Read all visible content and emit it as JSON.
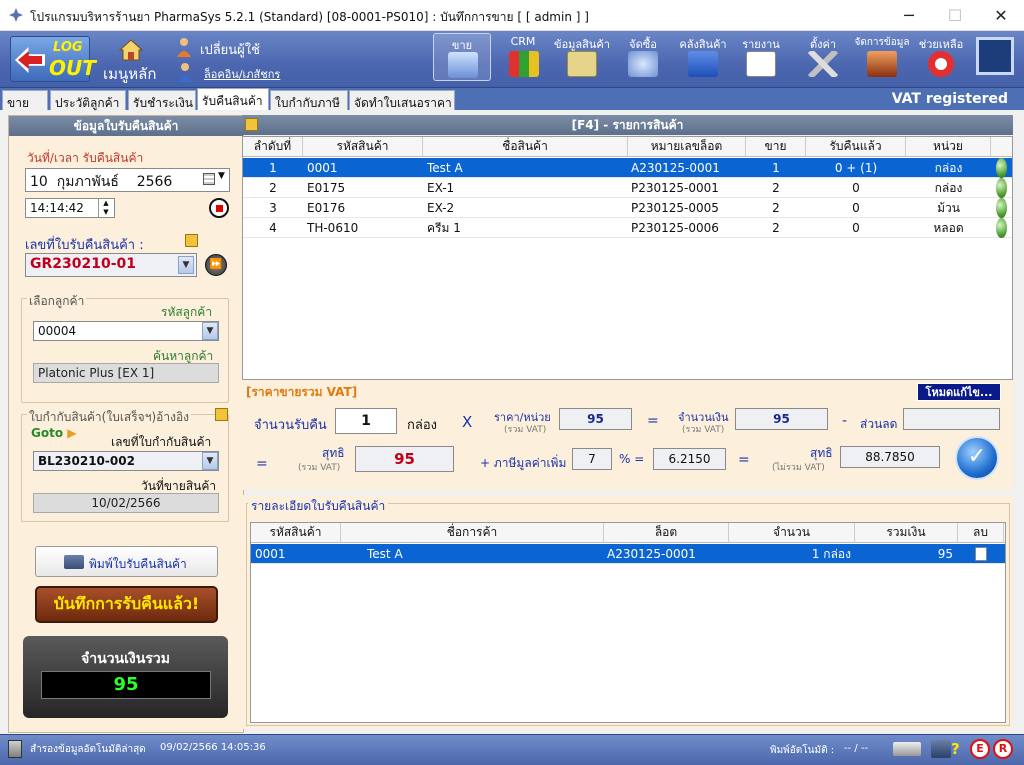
{
  "window": {
    "title": "โปรแกรมบริหารร้านยา PharmaSys 5.2.1 (Standard) [08-0001-PS010] : บันทึกการขาย  [ [ admin ] ]",
    "minimize": "─",
    "maximize": "☐",
    "close": "✕"
  },
  "toolbar": {
    "logout_top": "LOG",
    "logout_bottom": "OUT",
    "home": "เมนูหลัก",
    "change_user": "เปลี่ยนผู้ใช้",
    "login_link": "ล็อคอิน/เภสัชกร",
    "items": [
      {
        "label": "ขาย",
        "icon": "pos-icon"
      },
      {
        "label": "CRM",
        "icon": "crm-icon"
      },
      {
        "label": "ข้อมูลสินค้า",
        "icon": "product-icon"
      },
      {
        "label": "จัดซื้อ",
        "icon": "purchase-icon"
      },
      {
        "label": "คลังสินค้า",
        "icon": "warehouse-icon"
      },
      {
        "label": "รายงาน",
        "icon": "report-icon"
      },
      {
        "label": "ตั้งค่า",
        "icon": "settings-icon"
      },
      {
        "label": "จัดการข้อมูล",
        "icon": "data-icon"
      },
      {
        "label": "ช่วยเหลือ",
        "icon": "help-icon"
      }
    ]
  },
  "tabs": [
    "ขาย",
    "ประวัติลูกค้า",
    "รับชำระเงิน",
    "รับคืนสินค้า",
    "ใบกำกับภาษี",
    "จัดทำใบเสนอราคา"
  ],
  "vat_registered": "VAT registered",
  "left": {
    "header": "ข้อมูลใบรับคืนสินค้า",
    "datetime_label": "วันที่/เวลา รับคืนสินค้า",
    "date_day": "10",
    "date_month": "กุมภาพันธ์",
    "date_year": "2566",
    "time": "14:14:42",
    "doc_no_label": "เลขที่ใบรับคืนสินค้า :",
    "doc_no": "GR230210-01",
    "customer_group": "เลือกลูกค้า",
    "customer_code_label": "รหัสลูกค้า",
    "customer_code": "00004",
    "customer_search_label": "ค้นหาลูกค้า",
    "customer_name": "Platonic Plus [EX 1]",
    "ref_group": "ใบกำกับสินค้า(ใบเสร็จฯ)อ้างอิง",
    "goto": "Goto",
    "ref_no_label": "เลขที่ใบกำกับสินค้า",
    "ref_no": "BL230210-002",
    "sale_date_label": "วันที่ขายสินค้า",
    "sale_date": "10/02/2566",
    "print_button": "พิมพ์ใบรับคืนสินค้า",
    "save_button": "บันทึกการรับคืนแล้ว!",
    "total_label": "จำนวนเงินรวม",
    "total_value": "95"
  },
  "items_table": {
    "title": "[F4] - รายการสินค้า",
    "columns": [
      "ลำดับที่",
      "รหัสสินค้า",
      "ชื่อสินค้า",
      "หมายเลขล็อต",
      "ขาย",
      "รับคืนแล้ว",
      "หน่วย"
    ],
    "rows": [
      {
        "no": "1",
        "code": "0001",
        "name": "Test A",
        "lot": "A230125-0001",
        "sold": "1",
        "returned": "0 + (1)",
        "unit": "กล่อง"
      },
      {
        "no": "2",
        "code": "E0175",
        "name": "EX-1",
        "lot": "P230125-0001",
        "sold": "2",
        "returned": "0",
        "unit": "กล่อง"
      },
      {
        "no": "3",
        "code": "E0176",
        "name": "EX-2",
        "lot": "P230125-0005",
        "sold": "2",
        "returned": "0",
        "unit": "ม้วน"
      },
      {
        "no": "4",
        "code": "TH-0610",
        "name": "ครีม 1",
        "lot": "P230125-0006",
        "sold": "2",
        "returned": "0",
        "unit": "หลอด"
      }
    ]
  },
  "calc": {
    "title": "[ราคาขายรวม VAT]",
    "mode_button": "โหมดแก้ไข...",
    "qty_label": "จำนวนรับคืน",
    "qty": "1",
    "unit": "กล่อง",
    "times": "X",
    "price_label": "ราคา/หน่วย",
    "price_sub": "(รวม VAT)",
    "price": "95",
    "eq": "=",
    "amount_label": "จำนวนเงิน",
    "amount_sub": "(รวม VAT)",
    "amount": "95",
    "minus": "-",
    "discount_label": "ส่วนลด",
    "discount": "",
    "net_label": "สุทธิ",
    "net_sub": "(รวม VAT)",
    "net": "95",
    "vat_label": "+ ภาษีมูลค่าเพิ่ม",
    "vat_rate": "7",
    "pct": "% =",
    "vat_amount": "6.2150",
    "net_ex_label": "สุทธิ",
    "net_ex_sub": "(ไม่รวม VAT)",
    "net_ex": "88.7850"
  },
  "details": {
    "title": "รายละเอียดใบรับคืนสินค้า",
    "columns": [
      "รหัสสินค้า",
      "ชื่อการค้า",
      "ล็อต",
      "จำนวน",
      "รวมเงิน",
      "ลบ"
    ],
    "rows": [
      {
        "code": "0001",
        "name": "Test A",
        "lot": "A230125-0001",
        "qty": "1 กล่อง",
        "total": "95"
      }
    ]
  },
  "status": {
    "backup": "สำรองข้อมูลอัตโนมัติล่าสุด",
    "backup_time": "09/02/2566 14:05:36",
    "auto_print": "พิมพ์อัตโนมัติ :",
    "auto_print_val": "--  /  --"
  }
}
